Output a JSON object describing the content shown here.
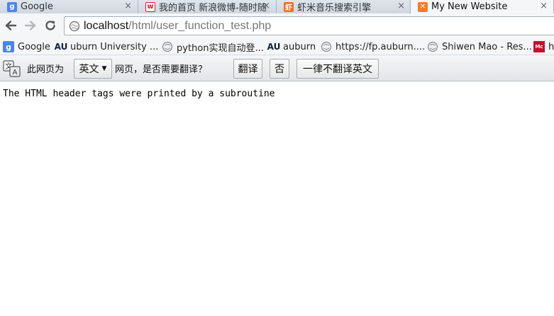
{
  "tabs": [
    {
      "title": "Google",
      "favicon": "google-g-icon",
      "active": false
    },
    {
      "title": "我的首页 新浪微博-随时随",
      "favicon": "weibo-icon",
      "active": false
    },
    {
      "title": "虾米音乐搜索引擎",
      "favicon": "xiami-icon",
      "active": false
    },
    {
      "title": "My New Website",
      "favicon": "xampp-icon",
      "active": true
    }
  ],
  "tab_close_glyph": "×",
  "address": {
    "host": "localhost",
    "path": "/html/user_function_test.php"
  },
  "bookmarks": [
    {
      "label": "Google",
      "icon": "google-g-icon"
    },
    {
      "label": "uburn University ...",
      "icon": "auburn-au-icon"
    },
    {
      "label": "python实现自动登...",
      "icon": "globe-icon"
    },
    {
      "label": "auburn",
      "icon": "auburn-au-icon"
    },
    {
      "label": "https://fp.auburn....",
      "icon": "globe-icon"
    },
    {
      "label": "Shiwen Mao - Res...",
      "icon": "globe-icon"
    },
    {
      "label": "h",
      "icon": "mcgraw-icon"
    }
  ],
  "translate_bar": {
    "prefix": "此网页为",
    "language": "英文",
    "question": "网页，是否需要翻译？",
    "translate_label": "翻译",
    "no_label": "否",
    "never_label": "一律不翻译英文"
  },
  "page": {
    "text": "The HTML header tags were printed by a subroutine"
  },
  "colors": {
    "google_blue": "#4a86e8",
    "weibo_red": "#e6162d",
    "xiami_orange": "#f56d24",
    "xampp_orange": "#fb7a24",
    "auburn_navy": "#0c2340"
  }
}
